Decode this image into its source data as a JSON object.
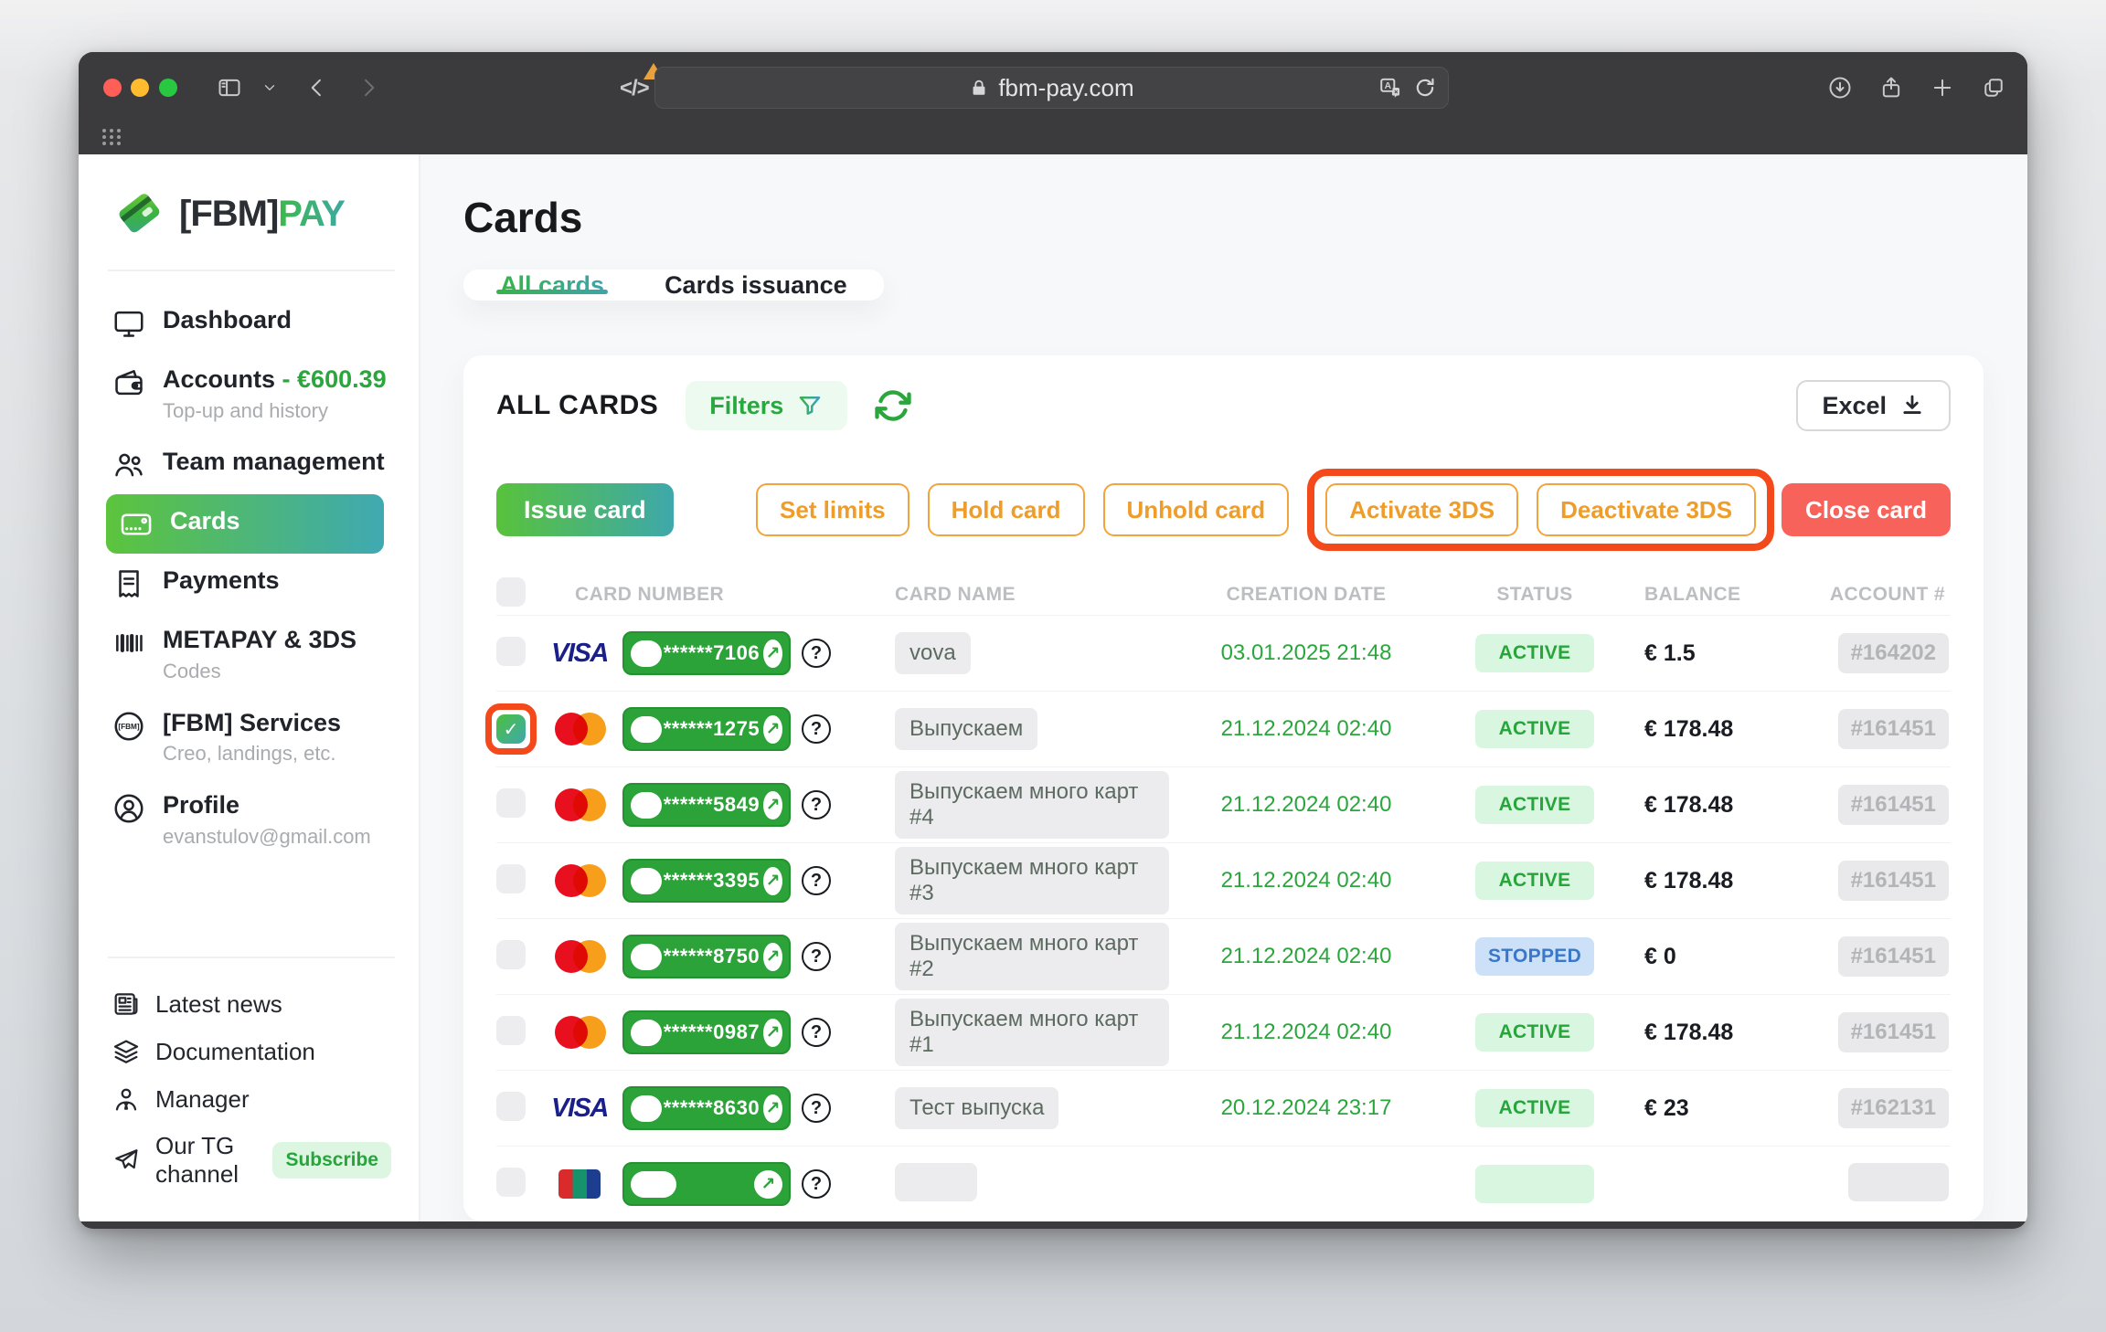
{
  "browser": {
    "url": "fbm-pay.com"
  },
  "sidebar": {
    "logo_text_dark": "[FBM]",
    "logo_text_green": "PAY",
    "items": [
      {
        "label": "Dashboard"
      },
      {
        "label": "Accounts",
        "value": "- €600.39",
        "sub": "Top-up and history"
      },
      {
        "label": "Team management"
      },
      {
        "label": "Cards"
      },
      {
        "label": "Payments"
      },
      {
        "label": "METAPAY & 3DS",
        "sub": "Codes"
      },
      {
        "label": "[FBM] Services",
        "sub": "Creo, landings, etc."
      },
      {
        "label": "Profile",
        "sub": "evanstulov@gmail.com"
      }
    ],
    "footer_items": [
      {
        "label": "Latest news"
      },
      {
        "label": "Documentation"
      },
      {
        "label": "Manager"
      },
      {
        "label": "Our TG channel",
        "badge": "Subscribe"
      }
    ]
  },
  "main": {
    "title": "Cards",
    "tabs": [
      {
        "label": "All cards"
      },
      {
        "label": "Cards issuance"
      }
    ],
    "toolbar": {
      "heading": "ALL CARDS",
      "filters": "Filters",
      "excel": "Excel"
    },
    "actions": {
      "issue": "Issue card",
      "set_limits": "Set limits",
      "hold": "Hold card",
      "unhold": "Unhold card",
      "activate": "Activate 3DS",
      "deactivate": "Deactivate 3DS",
      "close": "Close card"
    },
    "table": {
      "headers": [
        "CARD NUMBER",
        "CARD NAME",
        "CREATION DATE",
        "STATUS",
        "BALANCE",
        "ACCOUNT #"
      ],
      "rows": [
        {
          "brand": "visa",
          "number": "******7106",
          "name": "vova",
          "date": "03.01.2025 21:48",
          "status": "ACTIVE",
          "balance": "€ 1.5",
          "account": "#164202",
          "checked": false
        },
        {
          "brand": "mastercard",
          "number": "******1275",
          "name": "Выпускаем",
          "date": "21.12.2024 02:40",
          "status": "ACTIVE",
          "balance": "€ 178.48",
          "account": "#161451",
          "checked": true
        },
        {
          "brand": "mastercard",
          "number": "******5849",
          "name": "Выпускаем много карт #4",
          "date": "21.12.2024 02:40",
          "status": "ACTIVE",
          "balance": "€ 178.48",
          "account": "#161451",
          "checked": false
        },
        {
          "brand": "mastercard",
          "number": "******3395",
          "name": "Выпускаем много карт #3",
          "date": "21.12.2024 02:40",
          "status": "ACTIVE",
          "balance": "€ 178.48",
          "account": "#161451",
          "checked": false
        },
        {
          "brand": "mastercard",
          "number": "******8750",
          "name": "Выпускаем много карт #2",
          "date": "21.12.2024 02:40",
          "status": "STOPPED",
          "balance": "€ 0",
          "account": "#161451",
          "checked": false
        },
        {
          "brand": "mastercard",
          "number": "******0987",
          "name": "Выпускаем много карт #1",
          "date": "21.12.2024 02:40",
          "status": "ACTIVE",
          "balance": "€ 178.48",
          "account": "#161451",
          "checked": false
        },
        {
          "brand": "visa",
          "number": "******8630",
          "name": "Тест выпуска",
          "date": "20.12.2024 23:17",
          "status": "ACTIVE",
          "balance": "€ 23",
          "account": "#162131",
          "checked": false
        },
        {
          "brand": "stripes",
          "number": "",
          "name": "",
          "date": "",
          "status": "",
          "balance": "",
          "account": "",
          "checked": false
        }
      ]
    }
  },
  "colors": {
    "accent_green": "#2aa63c",
    "accent_teal": "#3fa9b2",
    "action_orange": "#ef9d2a",
    "annotation_orange": "#f4491a",
    "close_red": "#f7625b",
    "stopped_blue": "#3a77c8"
  }
}
